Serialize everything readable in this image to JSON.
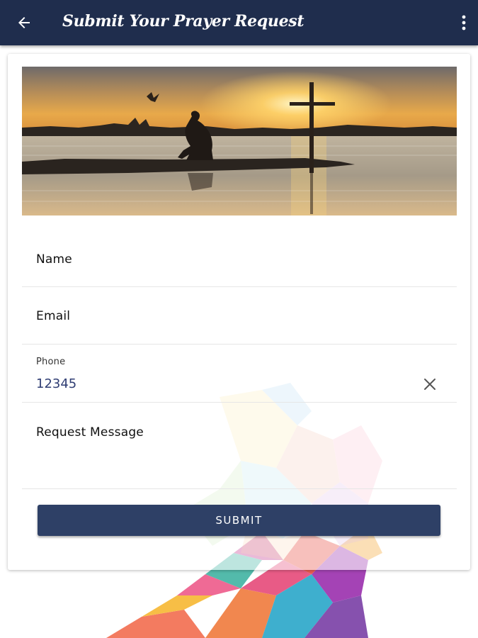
{
  "appbar": {
    "title": "Submit Your Prayer Request",
    "back_icon": "arrow-left-icon",
    "menu_icon": "more-vertical-icon",
    "background_color": "#1f2d4d"
  },
  "banner": {
    "description_icon": "banner-image"
  },
  "form": {
    "name": {
      "label": "Name",
      "value": ""
    },
    "email": {
      "label": "Email",
      "value": ""
    },
    "phone": {
      "label": "Phone",
      "value": "12345",
      "clear_icon": "close-icon"
    },
    "message": {
      "label": "Request Message",
      "value": ""
    }
  },
  "submit": {
    "label": "SUBMIT",
    "color": "#2e4066"
  },
  "accent_color": "#2f3d73"
}
